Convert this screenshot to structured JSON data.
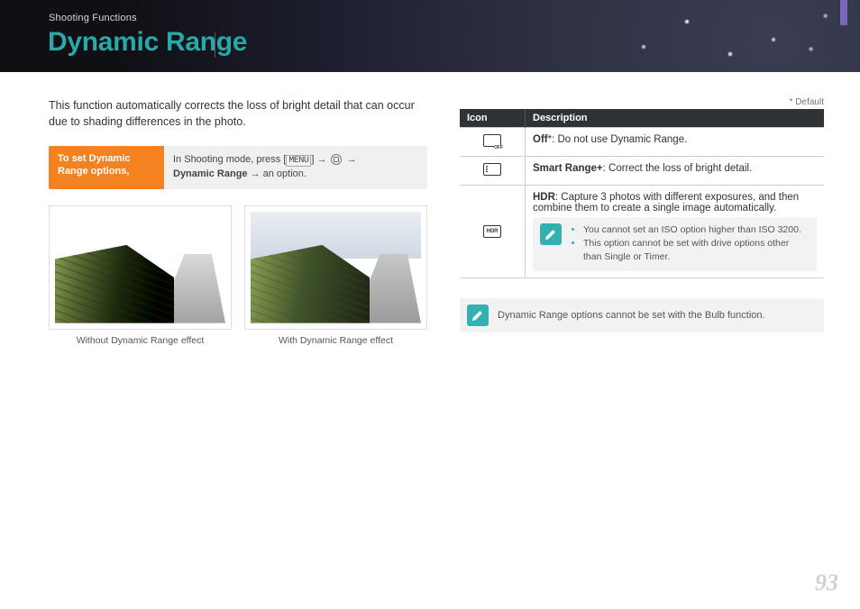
{
  "header": {
    "breadcrumb": "Shooting Functions",
    "title": "Dynamic Range"
  },
  "intro": "This function automatically corrects the loss of bright detail that can occur due to shading differences in the photo.",
  "instruction": {
    "label": "To set Dynamic Range options,",
    "pre": "In Shooting mode, press [",
    "menu_key": "MENU",
    "mid": "] → ",
    "after_icon": " → ",
    "bold": "Dynamic Range",
    "tail": " → an option."
  },
  "photos": {
    "without_caption": "Without Dynamic Range effect",
    "with_caption": "With Dynamic Range effect"
  },
  "table": {
    "default_note": "* Default",
    "head_icon": "Icon",
    "head_desc": "Description",
    "rows": [
      {
        "bold": "Off",
        "suffix": "*: Do not use Dynamic Range."
      },
      {
        "bold": "Smart Range+",
        "suffix": ": Correct the loss of bright detail."
      },
      {
        "bold": "HDR",
        "suffix": ": Capture 3 photos with different exposures, and then combine them to create a single image automatically."
      }
    ],
    "hdr_notes": [
      "You cannot set an ISO option higher than ISO 3200.",
      "This option cannot be set with drive options other than Single or Timer."
    ]
  },
  "footer_note": "Dynamic Range options cannot be set with the Bulb function.",
  "page_number": "93"
}
